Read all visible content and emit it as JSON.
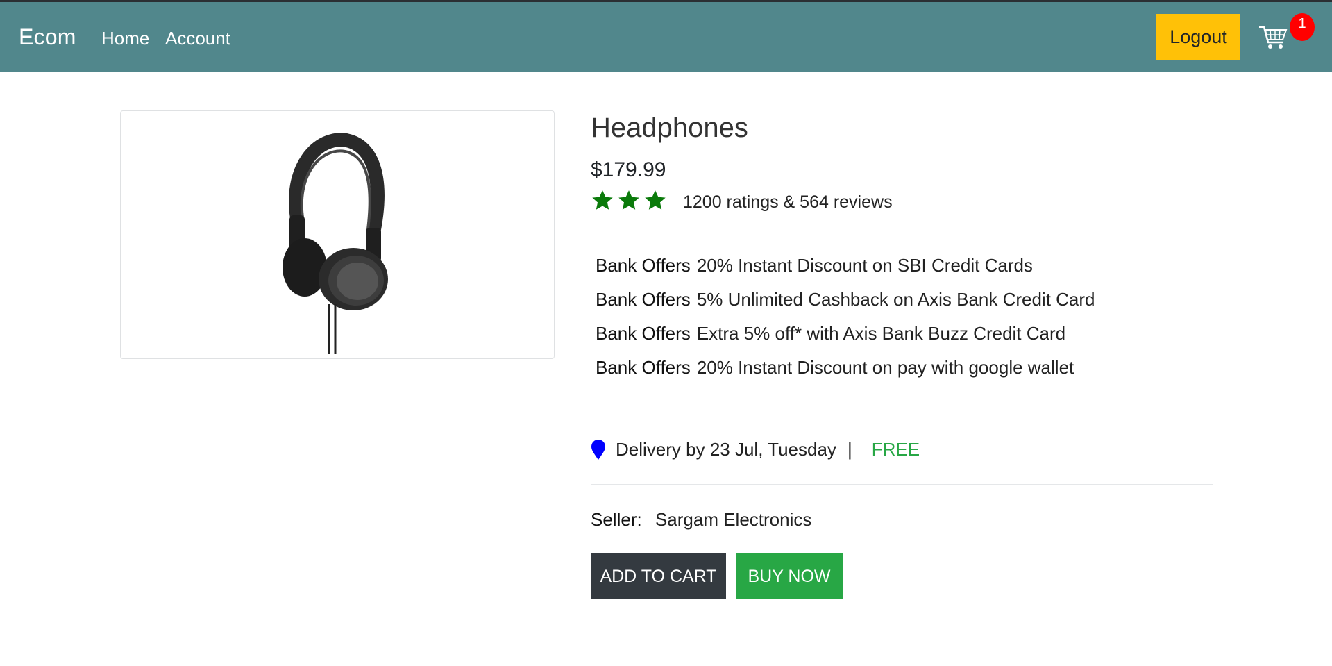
{
  "navbar": {
    "brand": "Ecom",
    "links": [
      "Home",
      "Account"
    ],
    "logout_label": "Logout",
    "cart_count": "1"
  },
  "product": {
    "title": "Headphones",
    "price": "$179.99",
    "rating_stars": 3,
    "rating_text": "1200 ratings & 564 reviews",
    "offers": [
      {
        "label": "Bank Offers",
        "text": "20% Instant Discount on SBI Credit Cards"
      },
      {
        "label": "Bank Offers",
        "text": "5% Unlimited Cashback on Axis Bank Credit Card"
      },
      {
        "label": "Bank Offers",
        "text": "Extra 5% off* with Axis Bank Buzz Credit Card"
      },
      {
        "label": "Bank Offers",
        "text": "20% Instant Discount on pay with  google wallet"
      }
    ],
    "delivery_text": "Delivery by 23 Jul, Tuesday",
    "delivery_separator": "|",
    "delivery_cost": "FREE",
    "seller_label": "Seller:",
    "seller_name": "Sargam Electronics"
  },
  "actions": {
    "add_to_cart": "ADD TO CART",
    "buy_now": "BUY NOW"
  },
  "colors": {
    "navbar": "#51878c",
    "logout": "#ffc107",
    "badge": "#ff0000",
    "star": "#0a7a0a",
    "free": "#28a745",
    "add_to_cart": "#343a40",
    "buy_now": "#28a745",
    "pin": "#0000ff"
  }
}
